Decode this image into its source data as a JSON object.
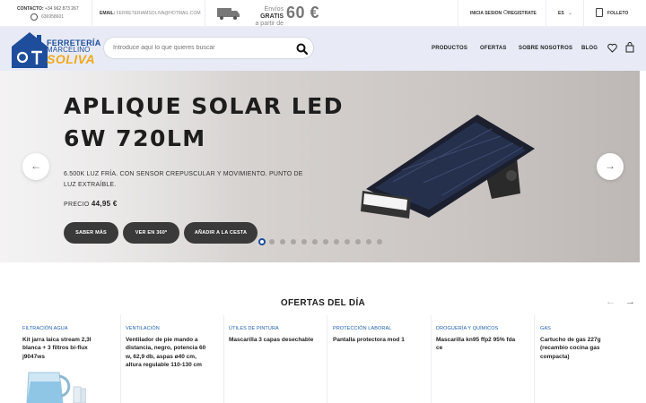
{
  "topbar": {
    "contact_label": "CONTACTO:",
    "phone": "+34 962 873 267",
    "whatsapp": "636958601",
    "email_label": "EMAIL:",
    "email": "FERRETERIAMSOLIVA@HOTMAIL.COM",
    "shipping_line1": "Envíos",
    "shipping_bold": "GRATIS",
    "shipping_line2": "a partir de",
    "shipping_amount": "60 €",
    "login": "INICIA SESION",
    "register": "REGISTRATE",
    "language": "ES",
    "brochure": "FOLLETO"
  },
  "header": {
    "logo_line1": "FERRETERÍA",
    "logo_line2": "MARCELINO",
    "logo_line3": "SOLIVA",
    "search_placeholder": "Introduce aquí lo que quieres buscar",
    "nav": [
      "PRODUCTOS",
      "OFERTAS",
      "SOBRE NOSOTROS",
      "BLOG"
    ]
  },
  "hero": {
    "title_line1": "APLIQUE SOLAR LED",
    "title_line2": "6W 720LM",
    "description": "6.500K LUZ FRÍA. CON SENSOR CREPUSCULAR Y MOVIMIENTO. PUNTO DE LUZ EXTRAÍBLE.",
    "price_label": "PRECIO",
    "price": "44,95 €",
    "buttons": [
      "SABER MÁS",
      "VER EN 360º",
      "AÑADIR A LA CESTA"
    ],
    "slide_count": 12,
    "active_slide": 1
  },
  "offers": {
    "title": "OFERTAS DEL DÍA",
    "products": [
      {
        "category": "FILTRACIÓN AGUA",
        "name": "Kit jarra laica stream 2,3l blanca + 3 filtros bi-flux j9047ws"
      },
      {
        "category": "VENTILACIÓN",
        "name": "Ventilador de pie mando a distancia, negro, potencia 60 w, 62,9 db, aspas ø40 cm, altura regulable 110-130 cm"
      },
      {
        "category": "ÚTILES DE PINTURA",
        "name": "Mascarilla 3 capas desechable"
      },
      {
        "category": "PROTECCIÓN LABORAL",
        "name": "Pantalla protectora mod 1"
      },
      {
        "category": "DROGUERÍA Y QUÍMICOS",
        "name": "Mascarilla kn95 ffp2 95% fda ce"
      },
      {
        "category": "GAS",
        "name": "Cartucho de gas 227g (recambio cocina gas compacta)"
      }
    ]
  },
  "colors": {
    "brand_blue": "#1e4e9b",
    "brand_orange": "#f0a91c",
    "header_bg": "#e8ebf6",
    "button_dark": "#3a3a3a"
  }
}
